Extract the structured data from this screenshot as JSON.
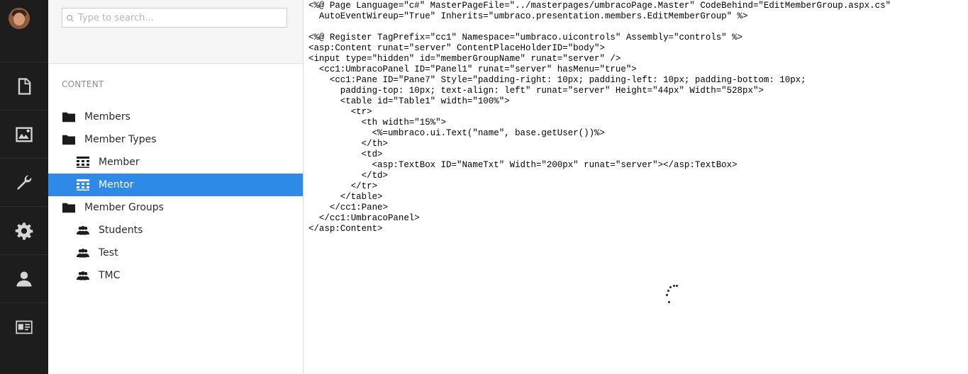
{
  "rail": {
    "items": [
      {
        "name": "content-icon"
      },
      {
        "name": "media-icon"
      },
      {
        "name": "settings-wrench-icon"
      },
      {
        "name": "developer-gear-icon"
      },
      {
        "name": "users-icon"
      },
      {
        "name": "members-card-icon"
      }
    ]
  },
  "search": {
    "placeholder": "Type to search..."
  },
  "tree": {
    "section_title": "CONTENT",
    "items": [
      {
        "label": "Members",
        "icon": "folder-icon",
        "level": 1,
        "selected": false
      },
      {
        "label": "Member Types",
        "icon": "folder-icon",
        "level": 1,
        "selected": false
      },
      {
        "label": "Member",
        "icon": "member-type-grid-icon",
        "level": 2,
        "selected": false
      },
      {
        "label": "Mentor",
        "icon": "member-type-grid-icon",
        "level": 2,
        "selected": true
      },
      {
        "label": "Member Groups",
        "icon": "folder-icon",
        "level": 1,
        "selected": false
      },
      {
        "label": "Students",
        "icon": "member-group-icon",
        "level": 2,
        "selected": false
      },
      {
        "label": "Test",
        "icon": "member-group-icon",
        "level": 2,
        "selected": false
      },
      {
        "label": "TMC",
        "icon": "member-group-icon",
        "level": 2,
        "selected": false
      }
    ]
  },
  "code": {
    "lines": [
      "<%@ Page Language=\"c#\" MasterPageFile=\"../masterpages/umbracoPage.Master\" CodeBehind=\"EditMemberGroup.aspx.cs\"",
      "  AutoEventWireup=\"True\" Inherits=\"umbraco.presentation.members.EditMemberGroup\" %>",
      "",
      "<%@ Register TagPrefix=\"cc1\" Namespace=\"umbraco.uicontrols\" Assembly=\"controls\" %>",
      "<asp:Content runat=\"server\" ContentPlaceHolderID=\"body\">",
      "<input type=\"hidden\" id=\"memberGroupName\" runat=\"server\" />",
      "  <cc1:UmbracoPanel ID=\"Panel1\" runat=\"server\" hasMenu=\"true\">",
      "    <cc1:Pane ID=\"Pane7\" Style=\"padding-right: 10px; padding-left: 10px; padding-bottom: 10px;",
      "      padding-top: 10px; text-align: left\" runat=\"server\" Height=\"44px\" Width=\"528px\">",
      "      <table id=\"Table1\" width=\"100%\">",
      "        <tr>",
      "          <th width=\"15%\">",
      "            <%=umbraco.ui.Text(\"name\", base.getUser())%>",
      "          </th>",
      "          <td>",
      "            <asp:TextBox ID=\"NameTxt\" Width=\"200px\" runat=\"server\"></asp:TextBox>",
      "          </td>",
      "        </tr>",
      "      </table>",
      "    </cc1:Pane>",
      "  </cc1:UmbracoPanel>",
      "</asp:Content>"
    ]
  },
  "colors": {
    "rail_bg": "#1d1d1d",
    "selected_bg": "#2e8ae6"
  }
}
